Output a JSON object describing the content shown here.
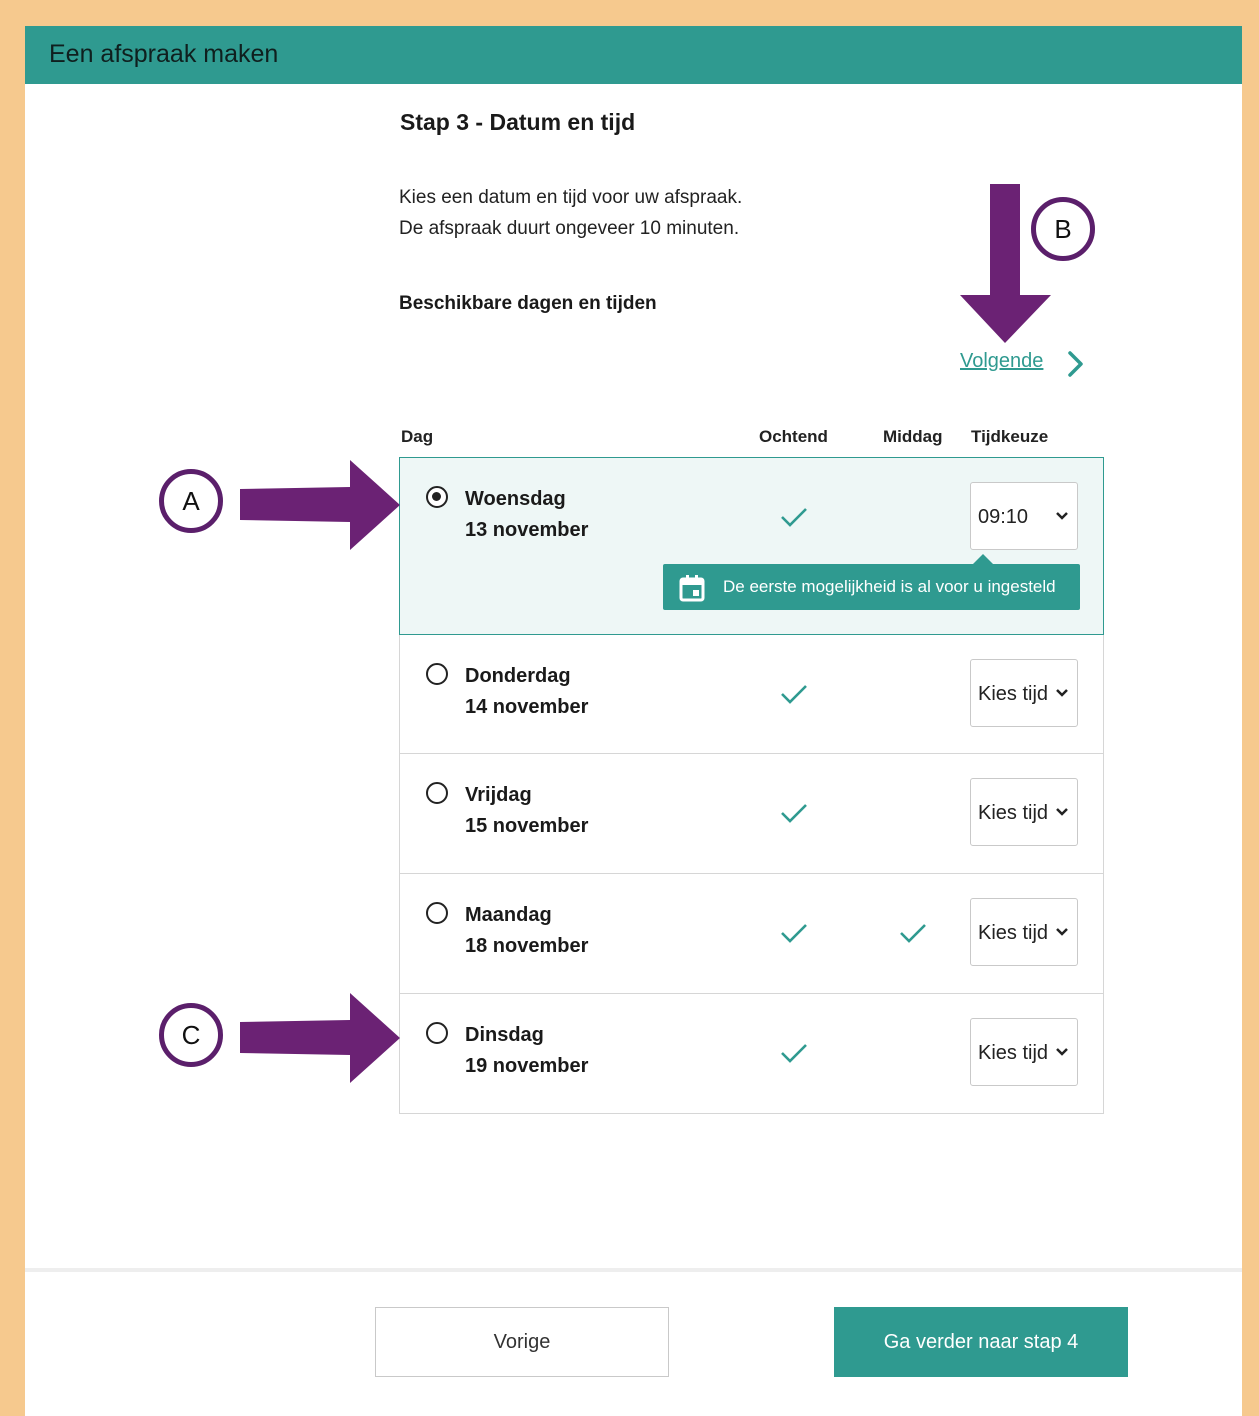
{
  "header": {
    "title": "Een afspraak maken"
  },
  "step": {
    "title": "Stap 3 - Datum en tijd",
    "intro_line1": "Kies een datum en tijd voor uw afspraak.",
    "intro_line2": "De afspraak duurt ongeveer 10 minuten.",
    "section_title": "Beschikbare dagen en tijden"
  },
  "nav": {
    "next_link": "Volgende"
  },
  "table": {
    "headers": {
      "day": "Dag",
      "morning": "Ochtend",
      "afternoon": "Middag",
      "time_choice": "Tijdkeuze"
    },
    "rows": [
      {
        "day": "Woensdag",
        "date": "13 november",
        "morning": true,
        "afternoon": false,
        "time": "09:10",
        "selected": true
      },
      {
        "day": "Donderdag",
        "date": "14 november",
        "morning": true,
        "afternoon": false,
        "time": "Kies tijd",
        "selected": false
      },
      {
        "day": "Vrijdag",
        "date": "15 november",
        "morning": true,
        "afternoon": false,
        "time": "Kies tijd",
        "selected": false
      },
      {
        "day": "Maandag",
        "date": "18 november",
        "morning": true,
        "afternoon": true,
        "time": "Kies tijd",
        "selected": false
      },
      {
        "day": "Dinsdag",
        "date": "19 november",
        "morning": true,
        "afternoon": false,
        "time": "Kies tijd",
        "selected": false
      }
    ],
    "tooltip": "De eerste mogelijkheid is al voor u ingesteld"
  },
  "footer": {
    "prev_label": "Vorige",
    "next_label": "Ga verder naar stap 4"
  },
  "annotations": {
    "a": "A",
    "b": "B",
    "c": "C"
  },
  "colors": {
    "brand": "#2f9a90",
    "annotation": "#5b1f6b",
    "frame": "#f6c98e"
  },
  "icons": {
    "check": "check-icon",
    "calendar": "calendar-icon",
    "chevron": "chevron-right-icon",
    "dropdown": "chevron-down-icon"
  }
}
